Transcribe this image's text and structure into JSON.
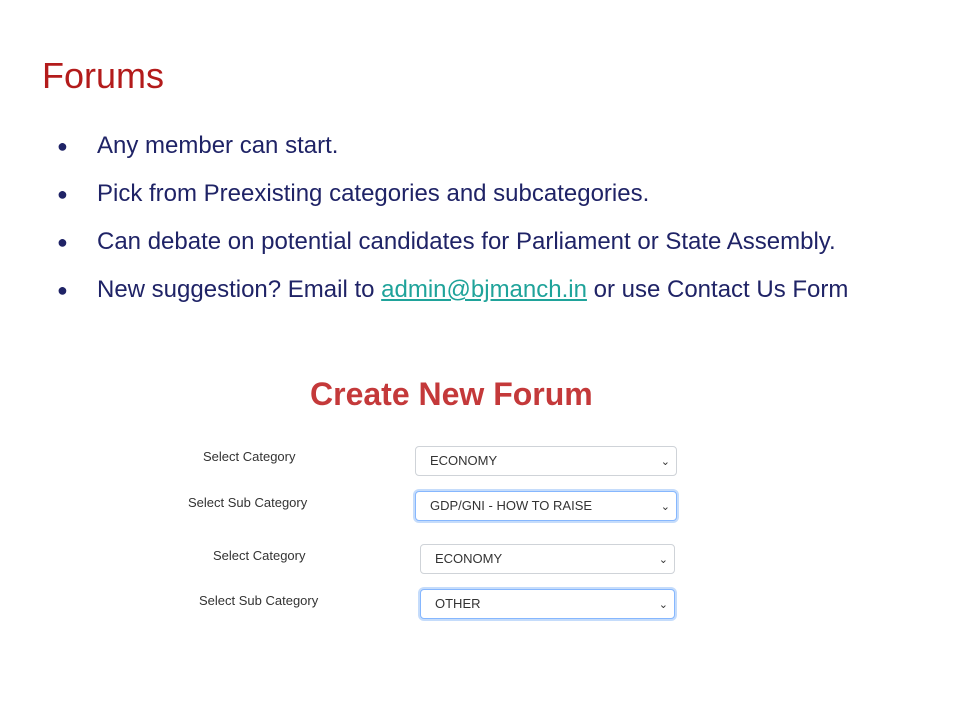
{
  "slide": {
    "title": "Forums",
    "bullets": [
      {
        "text": "Any member can start."
      },
      {
        "text": "Pick from Preexisting categories and subcategories."
      },
      {
        "text": "Can debate on potential candidates for Parliament or State Assembly."
      },
      {
        "before": "New suggestion? Email to ",
        "link": "admin@bjmanch.in",
        "after": " or use Contact Us Form"
      }
    ],
    "bullet_glyph": "●"
  },
  "form": {
    "heading": "Create New Forum",
    "rows": [
      {
        "label": "Select Category",
        "value": "ECONOMY",
        "focused": false
      },
      {
        "label": "Select Sub Category",
        "value": "GDP/GNI - HOW TO RAISE",
        "focused": true
      },
      {
        "label": "Select Category",
        "value": "ECONOMY",
        "focused": false
      },
      {
        "label": "Select Sub Category",
        "value": "OTHER",
        "focused": true
      }
    ],
    "chevron_icon": "chevron-down-icon"
  },
  "colors": {
    "title": "#b31b1b",
    "text": "#1f2366",
    "link": "#1fa39a",
    "form_heading": "#c4393a",
    "focus": "#86b7fe"
  }
}
